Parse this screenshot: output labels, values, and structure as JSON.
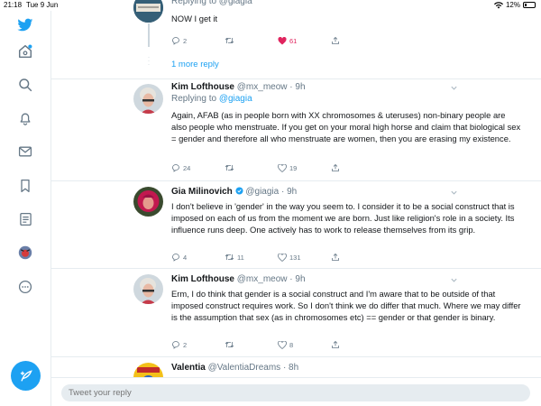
{
  "status": {
    "time": "21:18",
    "date": "Tue 9 Jun",
    "battery": "12%"
  },
  "sidebar": {
    "items": [
      {
        "icon": "twitter-logo-icon"
      },
      {
        "icon": "home-icon"
      },
      {
        "icon": "search-icon"
      },
      {
        "icon": "notifications-icon"
      },
      {
        "icon": "messages-icon"
      },
      {
        "icon": "bookmarks-icon"
      },
      {
        "icon": "lists-icon"
      },
      {
        "icon": "profile-avatar"
      },
      {
        "icon": "more-icon"
      }
    ],
    "compose_icon": "compose-tweet-icon"
  },
  "top_tweet": {
    "replying": "Replying to @giagia",
    "text": "NOW I get it",
    "reply_count": "2",
    "like_count": "61",
    "more_replies": "1 more reply"
  },
  "tweets": [
    {
      "name": "Kim Lofthouse",
      "handle": "@mx_meow",
      "time": "· 9h",
      "replying_prefix": "Replying to ",
      "replying_to": "@giagia",
      "text": "Again, AFAB (as in people born with XX chromosomes & uteruses) non-binary people are also people who menstruate. If you get on your moral high horse and claim that biological sex = gender and therefore all who menstruate are women, then you are erasing my existence.",
      "replies": "24",
      "retweets": "",
      "likes": "19"
    },
    {
      "name": "Gia Milinovich",
      "handle": "@giagia",
      "time": "· 9h",
      "verified": true,
      "text": "I don't believe in 'gender' in the way you seem to. I consider it to be a social construct that is imposed on each of us from the moment we are born. Just like religion's role in a society. Its influence runs deep. One actively has to work to release themselves from its grip.",
      "replies": "4",
      "retweets": "11",
      "likes": "131"
    },
    {
      "name": "Kim Lofthouse",
      "handle": "@mx_meow",
      "time": "· 9h",
      "text": "Erm, I do think that gender is a social construct and I'm aware that to be outside of that imposed construct requires work. So I don't think we do differ that much. Where we may differ is the assumption that sex (as in chromosomes etc) == gender or that gender is binary.",
      "replies": "2",
      "retweets": "",
      "likes": "8"
    },
    {
      "name": "Valentia",
      "handle": "@ValentiaDreams",
      "time": "· 8h"
    }
  ],
  "reply_bar": {
    "placeholder": "Tweet your reply"
  },
  "colors": {
    "accent": "#1da1f2",
    "like": "#e0245e",
    "muted": "#657786",
    "border": "#e6ecf0"
  }
}
